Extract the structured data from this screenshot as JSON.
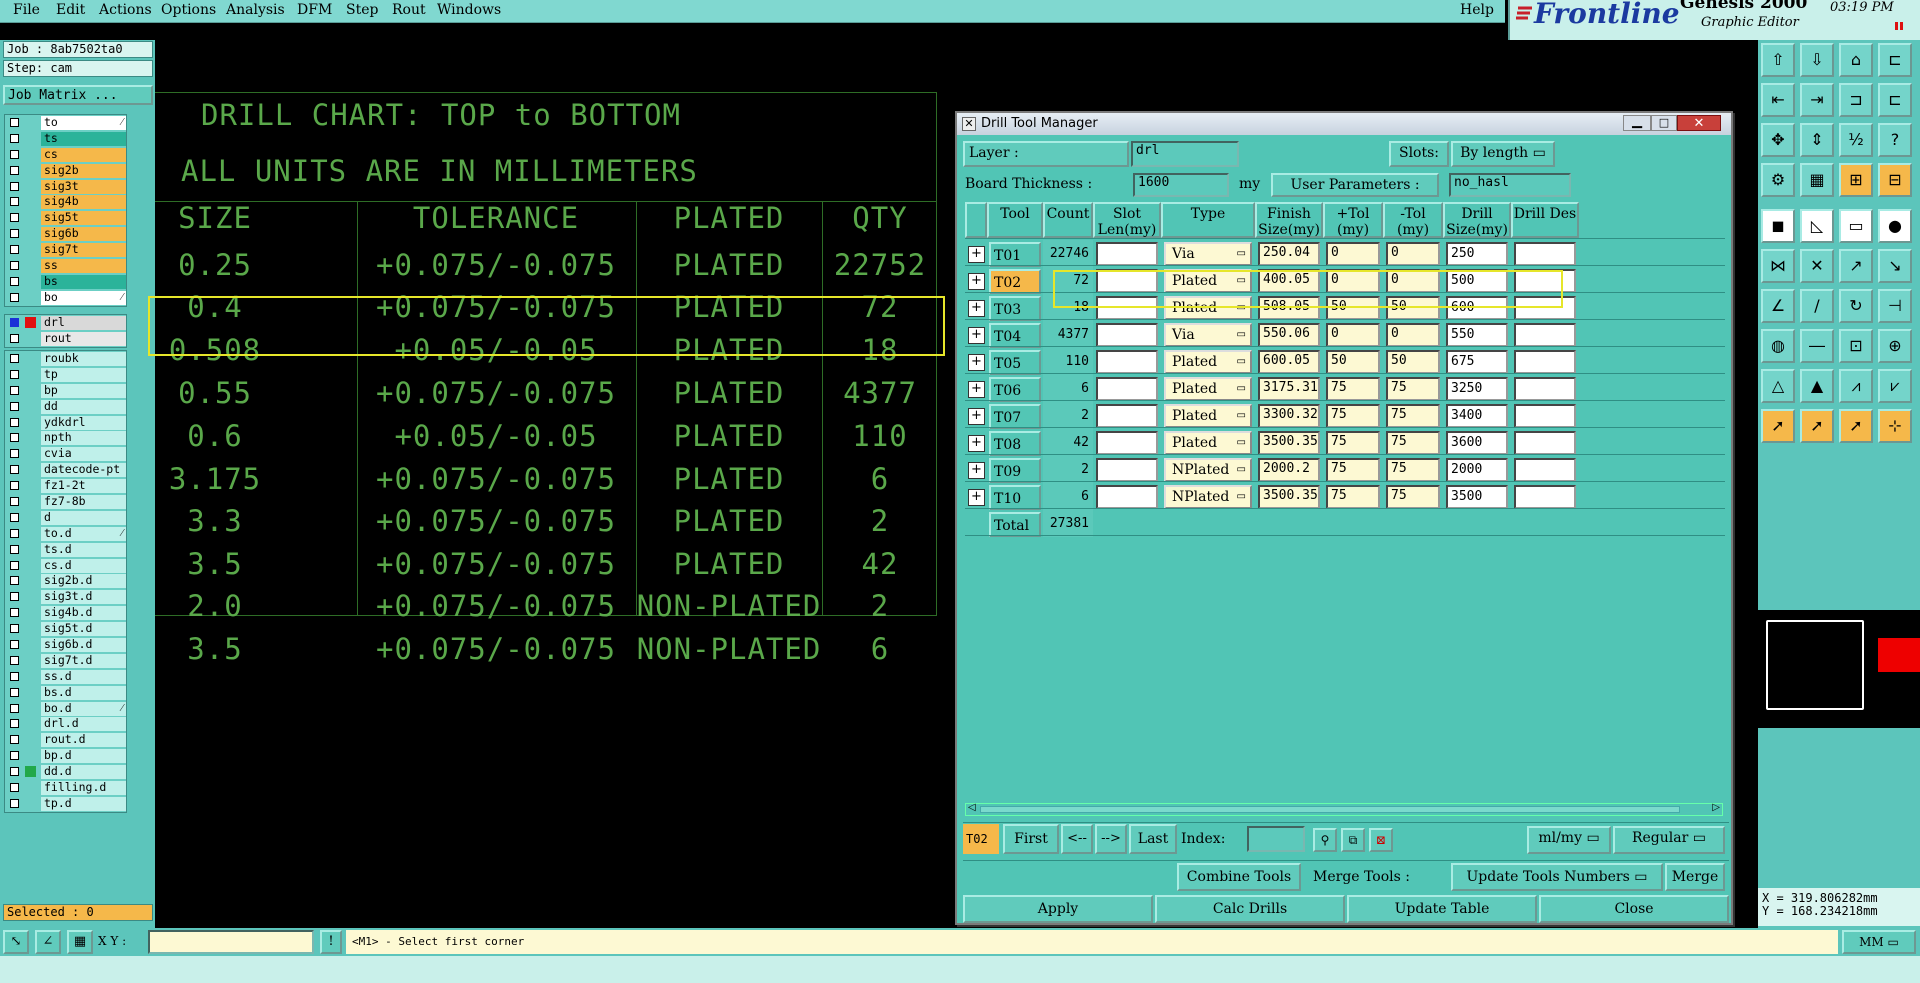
{
  "menu": {
    "items": [
      "File",
      "Edit",
      "Actions",
      "Options",
      "Analysis",
      "DFM",
      "Step",
      "Rout",
      "Windows"
    ],
    "help": "Help"
  },
  "logo": {
    "brand": "Frontline",
    "product": "Genesis 2000",
    "subtitle": "Graphic Editor",
    "time": "03:19 PM"
  },
  "job": {
    "job": "Job : 8ab7502ta0",
    "step": "Step: cam",
    "matrix_button": "Job Matrix ..."
  },
  "layers_top": [
    "to",
    "ts",
    "cs",
    "sig2b",
    "sig3t",
    "sig4b",
    "sig5t",
    "sig6b",
    "sig7t",
    "ss",
    "bs",
    "bo"
  ],
  "layers_mid": [
    "drl",
    "rout"
  ],
  "layers_bottom": [
    "roubk",
    "tp",
    "bp",
    "dd",
    "ydkdrl",
    "npth",
    "cvia",
    "datecode-pt",
    "fz1-2t",
    "fz7-8b",
    "d",
    "to.d",
    "ts.d",
    "cs.d",
    "sig2b.d",
    "sig3t.d",
    "sig4b.d",
    "sig5t.d",
    "sig6b.d",
    "sig7t.d",
    "ss.d",
    "bs.d",
    "bo.d",
    "drl.d",
    "rout.d",
    "bp.d",
    "dd.d",
    "filling.d",
    "tp.d"
  ],
  "selected": "Selected : 0",
  "chart": {
    "title": "DRILL CHART: TOP to BOTTOM",
    "units": "ALL UNITS ARE IN MILLIMETERS",
    "headers": [
      "SIZE",
      "TOLERANCE",
      "PLATED",
      "QTY"
    ],
    "rows": [
      [
        "0.25",
        "+0.075/-0.075",
        "PLATED",
        "22752"
      ],
      [
        "0.4",
        "+0.075/-0.075",
        "PLATED",
        "72"
      ],
      [
        "0.508",
        "+0.05/-0.05",
        "PLATED",
        "18"
      ],
      [
        "0.55",
        "+0.075/-0.075",
        "PLATED",
        "4377"
      ],
      [
        "0.6",
        "+0.05/-0.05",
        "PLATED",
        "110"
      ],
      [
        "3.175",
        "+0.075/-0.075",
        "PLATED",
        "6"
      ],
      [
        "3.3",
        "+0.075/-0.075",
        "PLATED",
        "2"
      ],
      [
        "3.5",
        "+0.075/-0.075",
        "PLATED",
        "42"
      ],
      [
        "2.0",
        "+0.075/-0.075",
        "NON-PLATED",
        "2"
      ],
      [
        "3.5",
        "+0.075/-0.075",
        "NON-PLATED",
        "6"
      ]
    ]
  },
  "dialog": {
    "title": "Drill Tool Manager",
    "layer_label": "Layer         :",
    "layer_value": "drl",
    "slots_label": "Slots:",
    "slots_value": "By length",
    "thickness_label": "Board Thickness :",
    "thickness_value": "1600",
    "thickness_unit": "my",
    "user_params_label": "User Parameters :",
    "user_params_value": "no_hasl",
    "columns": [
      "Tool",
      "Count",
      "Slot Len(my)",
      "Type",
      "Finish Size(my)",
      "+Tol (my)",
      "-Tol (my)",
      "Drill Size(my)",
      "Drill Des"
    ],
    "rows": [
      {
        "tool": "T01",
        "count": "22746",
        "type": "Via",
        "finish": "250.04",
        "ptol": "0",
        "mtol": "0",
        "drill": "250"
      },
      {
        "tool": "T02",
        "count": "72",
        "type": "Plated",
        "finish": "400.05",
        "ptol": "0",
        "mtol": "0",
        "drill": "500"
      },
      {
        "tool": "T03",
        "count": "18",
        "type": "Plated",
        "finish": "508.05",
        "ptol": "50",
        "mtol": "50",
        "drill": "600"
      },
      {
        "tool": "T04",
        "count": "4377",
        "type": "Via",
        "finish": "550.06",
        "ptol": "0",
        "mtol": "0",
        "drill": "550"
      },
      {
        "tool": "T05",
        "count": "110",
        "type": "Plated",
        "finish": "600.05",
        "ptol": "50",
        "mtol": "50",
        "drill": "675"
      },
      {
        "tool": "T06",
        "count": "6",
        "type": "Plated",
        "finish": "3175.31",
        "ptol": "75",
        "mtol": "75",
        "drill": "3250"
      },
      {
        "tool": "T07",
        "count": "2",
        "type": "Plated",
        "finish": "3300.32",
        "ptol": "75",
        "mtol": "75",
        "drill": "3400"
      },
      {
        "tool": "T08",
        "count": "42",
        "type": "Plated",
        "finish": "3500.35",
        "ptol": "75",
        "mtol": "75",
        "drill": "3600"
      },
      {
        "tool": "T09",
        "count": "2",
        "type": "NPlated",
        "finish": "2000.2",
        "ptol": "75",
        "mtol": "75",
        "drill": "2000"
      },
      {
        "tool": "T10",
        "count": "6",
        "type": "NPlated",
        "finish": "3500.35",
        "ptol": "75",
        "mtol": "75",
        "drill": "3500"
      }
    ],
    "total_label": "Total",
    "total_value": "27381",
    "current_tool": "T02",
    "nav": {
      "first": "First",
      "prev": "<--",
      "next": "-->",
      "last": "Last",
      "index_label": "Index:"
    },
    "units_select": "ml/my",
    "mode_select": "Regular",
    "combine": "Combine Tools",
    "merge_label": "Merge Tools :",
    "update_numbers": "Update Tools Numbers",
    "merge": "Merge",
    "apply": "Apply",
    "calc": "Calc Drills",
    "update_table": "Update Table",
    "close": "Close"
  },
  "coords": {
    "x": "X = 319.806282mm",
    "y": "Y = 168.234218mm"
  },
  "status": {
    "xy_label": "X Y :",
    "prompt": "<M1> - Select first corner",
    "unit": "MM"
  },
  "colors": {
    "panel": "#5cc5bb",
    "highlight": "#e6e62a",
    "drill_text": "#5aa84a"
  }
}
